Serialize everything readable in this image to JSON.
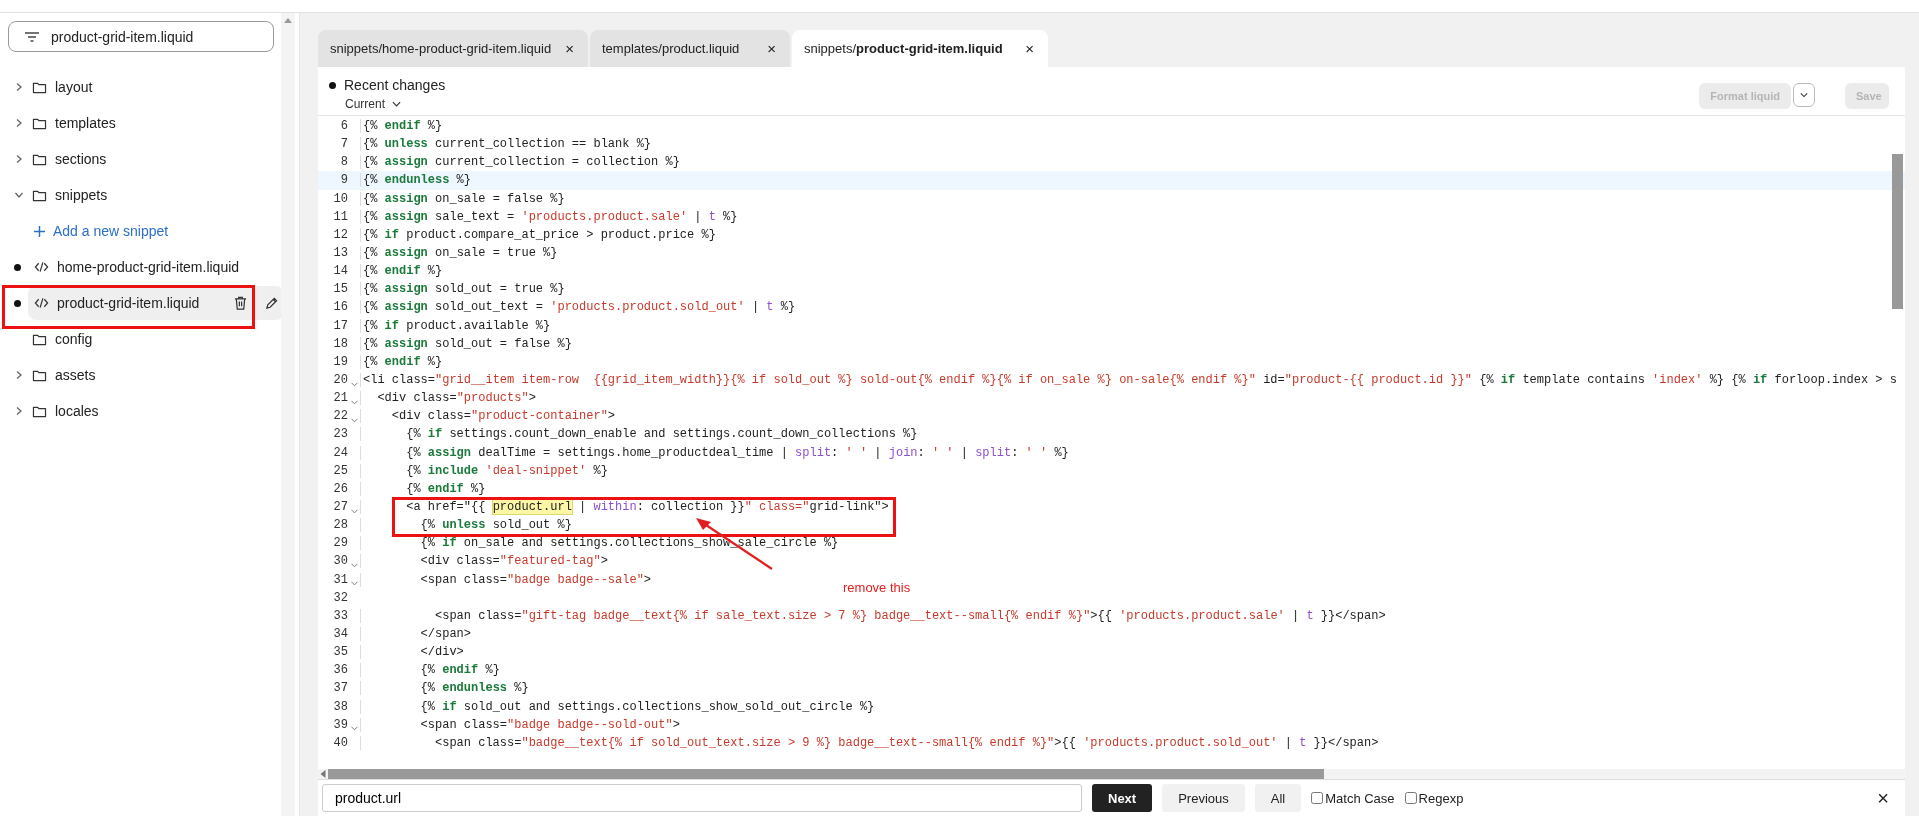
{
  "sidebar": {
    "filter": {
      "value": "product-grid-item.liquid"
    },
    "items": [
      {
        "kind": "folder",
        "label": "layout",
        "expandable": true,
        "expanded": false
      },
      {
        "kind": "folder",
        "label": "templates",
        "expandable": true,
        "expanded": false
      },
      {
        "kind": "folder",
        "label": "sections",
        "expandable": true,
        "expanded": false
      },
      {
        "kind": "folder",
        "label": "snippets",
        "expandable": true,
        "expanded": true,
        "children": [
          {
            "kind": "add",
            "label": "Add a new snippet"
          },
          {
            "kind": "file",
            "label": "home-product-grid-item.liquid",
            "modified": true,
            "selected": false
          },
          {
            "kind": "file",
            "label": "product-grid-item.liquid",
            "modified": true,
            "selected": true
          }
        ]
      },
      {
        "kind": "folder",
        "label": "config",
        "expandable": false
      },
      {
        "kind": "folder",
        "label": "assets",
        "expandable": true,
        "expanded": false
      },
      {
        "kind": "folder",
        "label": "locales",
        "expandable": true,
        "expanded": false
      }
    ]
  },
  "tabs": [
    {
      "folder": "snippets/",
      "file": "home-product-grid-item.liquid",
      "close": "×",
      "selected": false
    },
    {
      "folder": "templates/",
      "file": "product.liquid",
      "close": "×",
      "selected": false
    },
    {
      "folder": "snippets/",
      "file": "product-grid-item.liquid",
      "close": "×",
      "selected": true
    }
  ],
  "header": {
    "title": "Recent changes",
    "unsaved": true,
    "version": "Current",
    "format_button": {
      "label": "Format liquid",
      "disabled": true
    },
    "save_button": {
      "label": "Save",
      "disabled": true
    }
  },
  "code": [
    {
      "number": "6",
      "text": "{% endif %}",
      "fold": false,
      "current": false
    },
    {
      "number": "7",
      "text": "{% unless current_collection == blank %}",
      "fold": false,
      "current": false
    },
    {
      "number": "8",
      "text": "{% assign current_collection = collection %}",
      "fold": false,
      "current": false
    },
    {
      "number": "9",
      "text": "{% endunless %}",
      "fold": false,
      "current": true
    },
    {
      "number": "10",
      "text": "{% assign on_sale = false %}",
      "fold": false,
      "current": false
    },
    {
      "number": "11",
      "text": "{% assign sale_text = 'products.product.sale' | t %}",
      "fold": false,
      "current": false
    },
    {
      "number": "12",
      "text": "{% if product.compare_at_price > product.price %}",
      "fold": false,
      "current": false
    },
    {
      "number": "13",
      "text": "{% assign on_sale = true %}",
      "fold": false,
      "current": false
    },
    {
      "number": "14",
      "text": "{% endif %}",
      "fold": false,
      "current": false
    },
    {
      "number": "15",
      "text": "{% assign sold_out = true %}",
      "fold": false,
      "current": false
    },
    {
      "number": "16",
      "text": "{% assign sold_out_text = 'products.product.sold_out' | t %}",
      "fold": false,
      "current": false
    },
    {
      "number": "17",
      "text": "{% if product.available %}",
      "fold": false,
      "current": false
    },
    {
      "number": "18",
      "text": "{% assign sold_out = false %}",
      "fold": false,
      "current": false
    },
    {
      "number": "19",
      "text": "{% endif %}",
      "fold": false,
      "current": false
    },
    {
      "number": "20",
      "text": "<li class=\"grid__item item-row  {{grid_item_width}}{% if sold_out %} sold-out{% endif %}{% if on_sale %} on-sale{% endif %}\" id=\"product-{{ product.id }}\" {% if template contains 'index' %} {% if forloop.index > s",
      "fold": true,
      "current": false
    },
    {
      "number": "21",
      "text": "  <div class=\"products\">",
      "fold": true,
      "current": false
    },
    {
      "number": "22",
      "text": "    <div class=\"product-container\">",
      "fold": true,
      "current": false
    },
    {
      "number": "23",
      "text": "      {% if settings.count_down_enable and settings.count_down_collections %}",
      "fold": false,
      "current": false
    },
    {
      "number": "24",
      "text": "      {% assign dealTime = settings.home_productdeal_time | split: ' ' | join: ' ' | split: ' ' %}",
      "fold": false,
      "current": false
    },
    {
      "number": "25",
      "text": "      {% include 'deal-snippet' %}",
      "fold": false,
      "current": false
    },
    {
      "number": "26",
      "text": "      {% endif %}",
      "fold": false,
      "current": false
    },
    {
      "number": "27",
      "segments": [
        {
          "text": "      <a href=\"{{ ",
          "match": false
        },
        {
          "text": "product.url",
          "match": true
        },
        {
          "text": " | within: collection }}\" class=\"grid-link\">",
          "match": false
        }
      ],
      "fold": true,
      "current": false
    },
    {
      "number": "28",
      "text": "        {% unless sold_out %}",
      "fold": false,
      "current": false
    },
    {
      "number": "29",
      "text": "        {% if on_sale and settings.collections_show_sale_circle %}",
      "fold": false,
      "current": false
    },
    {
      "number": "30",
      "text": "        <div class=\"featured-tag\">",
      "fold": true,
      "current": false
    },
    {
      "number": "31",
      "text": "        <span class=\"badge badge--sale\">",
      "fold": true,
      "current": false
    },
    {
      "number": "32",
      "fold": false,
      "current": false
    },
    {
      "number": "33",
      "text": "          <span class=\"gift-tag badge__text{% if sale_text.size > 7 %} badge__text--small{% endif %}\">{{ 'products.product.sale' | t }}</span>",
      "fold": false,
      "current": false
    },
    {
      "number": "34",
      "text": "        </span>",
      "fold": false,
      "current": false
    },
    {
      "number": "35",
      "text": "        </div>",
      "fold": false,
      "current": false
    },
    {
      "number": "36",
      "text": "        {% endif %}",
      "fold": false,
      "current": false
    },
    {
      "number": "37",
      "text": "        {% endunless %}",
      "fold": false,
      "current": false
    },
    {
      "number": "38",
      "text": "        {% if sold_out and settings.collections_show_sold_out_circle %}",
      "fold": false,
      "current": false
    },
    {
      "number": "39",
      "text": "        <span class=\"badge badge--sold-out\">",
      "fold": true,
      "current": false
    },
    {
      "number": "40",
      "text": "          <span class=\"badge__text{% if sold_out_text.size > 9 %} badge__text--small{% endif %}\">{{ 'products.product.sold_out' | t }}</span>",
      "fold": false,
      "current": false
    }
  ],
  "find_bar": {
    "value": "product.url",
    "buttons": [
      {
        "label": "Next",
        "primary": true
      },
      {
        "label": "Previous",
        "primary": false
      },
      {
        "label": "All",
        "primary": false
      }
    ],
    "options": [
      {
        "label": "Match Case",
        "checked": false
      },
      {
        "label": "Regexp",
        "checked": false
      }
    ],
    "close": "×"
  },
  "annotation": {
    "note": "remove this"
  }
}
